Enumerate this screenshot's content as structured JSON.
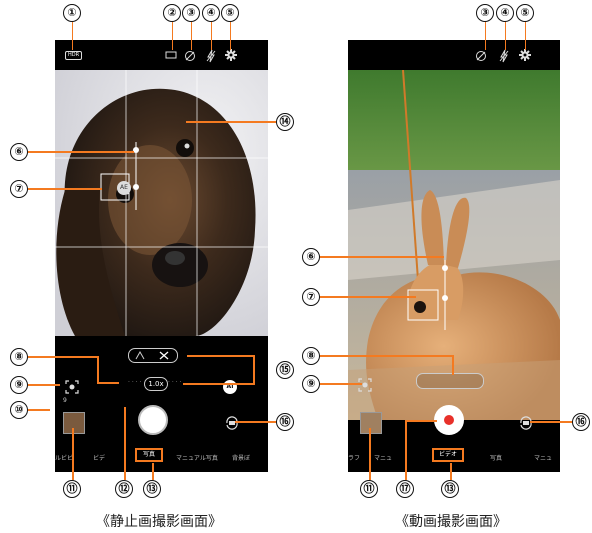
{
  "callouts": [
    "①",
    "②",
    "③",
    "④",
    "⑤",
    "⑥",
    "⑦",
    "⑧",
    "⑨",
    "⑩",
    "⑪",
    "⑫",
    "⑬",
    "⑭",
    "⑮",
    "⑯",
    "⑰"
  ],
  "captions": {
    "still": "《静止画撮影画面》",
    "video": "《動画撮影画面》"
  },
  "still_screen": {
    "hdr_badge": "HDR",
    "ae_label": "AE",
    "zoom_label": "1.0x",
    "ai_label": "AI",
    "counter": "9",
    "modes": [
      "ルビビ",
      "ビデ",
      "写真",
      "マニュアル写真",
      "背景ぼ"
    ],
    "selected_mode": "写真"
  },
  "video_screen": {
    "modes": [
      "ラフ",
      "マニュ",
      "ビデオ",
      "写真",
      "マニュ"
    ],
    "selected_mode": "ビデオ"
  },
  "colors": {
    "leader": "#f47a20",
    "record": "#e8302a"
  }
}
